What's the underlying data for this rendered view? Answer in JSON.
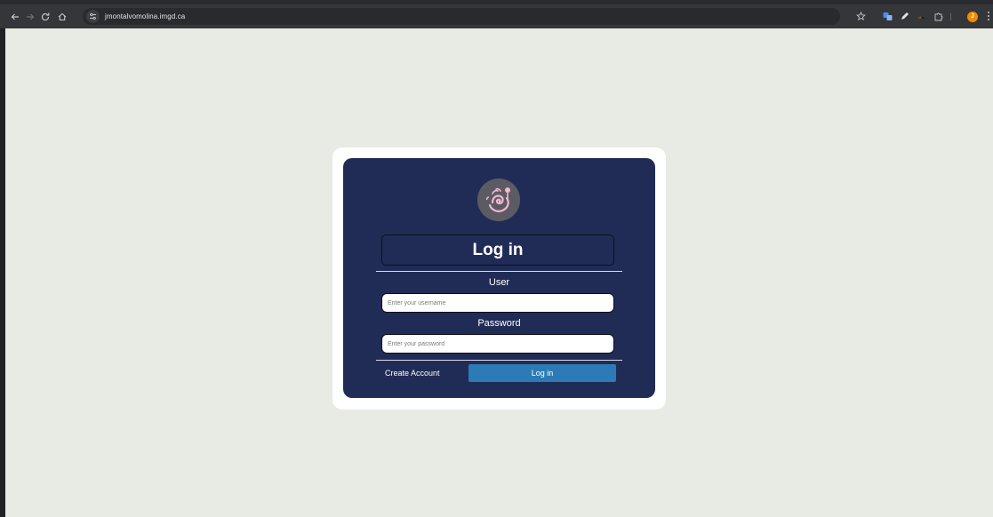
{
  "browser": {
    "url": "jmontalvomolina.imgd.ca",
    "profile_initial": "J",
    "accent_color": "#f28b00"
  },
  "icons": {
    "back": "arrow-left-icon",
    "forward": "arrow-right-icon",
    "reload": "reload-icon",
    "home": "home-icon",
    "site_info": "tune-icon",
    "bookmark": "star-icon",
    "extensions": [
      "translate-icon",
      "pen-icon",
      "extension-icon",
      "puzzle-icon"
    ],
    "menu": "kebab-menu-icon"
  },
  "login": {
    "title": "Log in",
    "user_label": "User",
    "username_placeholder": "Enter your username",
    "password_label": "Password",
    "password_placeholder": "Enter your password",
    "create_account": "Create Account",
    "submit_label": "Log in"
  },
  "colors": {
    "page_background": "#e8ebe4",
    "card_background": "#212c56",
    "button": "#2c7bb6"
  }
}
